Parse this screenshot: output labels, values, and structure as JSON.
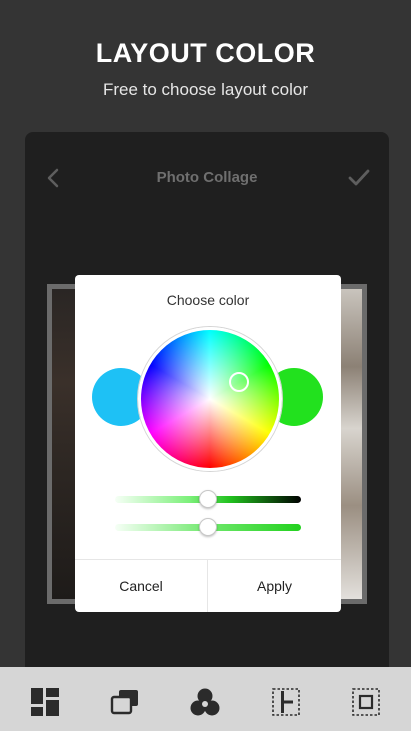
{
  "hero": {
    "title": "LAYOUT COLOR",
    "subtitle": "Free to choose layout color"
  },
  "app": {
    "title": "Photo Collage",
    "back_icon": "chevron-left-icon",
    "confirm_icon": "check-icon"
  },
  "dialog": {
    "title": "Choose color",
    "left_swatch_color": "#1ec1f5",
    "right_swatch_color": "#22e11e",
    "brightness_slider_value": 0.5,
    "saturation_slider_value": 0.5,
    "cancel_label": "Cancel",
    "apply_label": "Apply"
  },
  "toolbar": {
    "tools": [
      "layout-grid-icon",
      "overlap-frames-icon",
      "color-circles-icon",
      "border-width-icon",
      "frame-margin-icon"
    ]
  }
}
